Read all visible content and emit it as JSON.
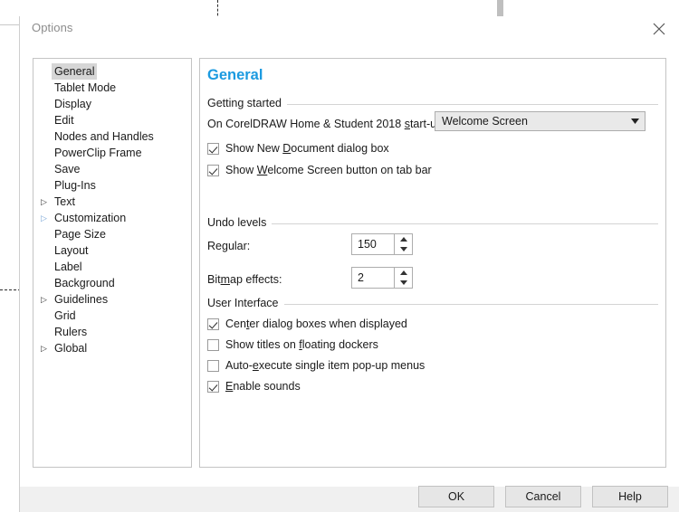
{
  "window": {
    "title": "Options",
    "close_icon": "close-icon"
  },
  "sidebar": {
    "items": [
      {
        "label": "General",
        "arrow": "",
        "selected": true,
        "arrow_style": ""
      },
      {
        "label": "Tablet Mode",
        "arrow": "",
        "selected": false,
        "arrow_style": ""
      },
      {
        "label": "Display",
        "arrow": "",
        "selected": false,
        "arrow_style": ""
      },
      {
        "label": "Edit",
        "arrow": "",
        "selected": false,
        "arrow_style": ""
      },
      {
        "label": "Nodes and Handles",
        "arrow": "",
        "selected": false,
        "arrow_style": ""
      },
      {
        "label": "PowerClip Frame",
        "arrow": "",
        "selected": false,
        "arrow_style": ""
      },
      {
        "label": "Save",
        "arrow": "",
        "selected": false,
        "arrow_style": ""
      },
      {
        "label": "Plug-Ins",
        "arrow": "",
        "selected": false,
        "arrow_style": ""
      },
      {
        "label": "Text",
        "arrow": "▷",
        "selected": false,
        "arrow_style": "dark"
      },
      {
        "label": "Customization",
        "arrow": "▷",
        "selected": false,
        "arrow_style": "blue"
      },
      {
        "label": "Page Size",
        "arrow": "",
        "selected": false,
        "arrow_style": ""
      },
      {
        "label": "Layout",
        "arrow": "",
        "selected": false,
        "arrow_style": ""
      },
      {
        "label": "Label",
        "arrow": "",
        "selected": false,
        "arrow_style": ""
      },
      {
        "label": "Background",
        "arrow": "",
        "selected": false,
        "arrow_style": ""
      },
      {
        "label": "Guidelines",
        "arrow": "▷",
        "selected": false,
        "arrow_style": "dark"
      },
      {
        "label": "Grid",
        "arrow": "",
        "selected": false,
        "arrow_style": ""
      },
      {
        "label": "Rulers",
        "arrow": "",
        "selected": false,
        "arrow_style": ""
      },
      {
        "label": "Global",
        "arrow": "▷",
        "selected": false,
        "arrow_style": "dark"
      }
    ]
  },
  "panel": {
    "title": "General",
    "title_color": "#1b9ae0",
    "groups": {
      "getting_started": {
        "label": "Getting started",
        "startup_label_pre": "On CorelDRAW Home & Student 2018 ",
        "startup_label_mnemonic": "s",
        "startup_label_post": "tart-up:",
        "startup_value": "Welcome Screen",
        "dropdown_icon": "chevron-down-icon",
        "checkbox_new_doc": {
          "pre": "Show New ",
          "mnemonic": "D",
          "post": "ocument dialog box",
          "checked": true
        },
        "checkbox_welcome_tab": {
          "pre": "Show ",
          "mnemonic": "W",
          "post": "elcome Screen button on tab bar",
          "checked": true
        }
      },
      "undo_levels": {
        "label": "Undo levels",
        "regular": {
          "pre": "Re",
          "mnemonic": "g",
          "post": "ular:",
          "value": "150"
        },
        "bitmap_effects": {
          "pre": "Bit",
          "mnemonic": "m",
          "post": "ap effects:",
          "value": "2"
        },
        "spinner_up_icon": "triangle-up-icon",
        "spinner_down_icon": "triangle-down-icon"
      },
      "user_interface": {
        "label": "User Interface",
        "options": [
          {
            "pre": "Cen",
            "mnemonic": "t",
            "post": "er dialog boxes when displayed",
            "checked": true
          },
          {
            "pre": "Show titles on ",
            "mnemonic": "f",
            "post": "loating dockers",
            "checked": false
          },
          {
            "pre": "Auto-",
            "mnemonic": "e",
            "post": "xecute single item pop-up menus",
            "checked": false
          },
          {
            "pre": "",
            "mnemonic": "E",
            "post": "nable sounds",
            "checked": true
          }
        ]
      }
    }
  },
  "footer": {
    "ok": "OK",
    "cancel": "Cancel",
    "help": "Help"
  }
}
